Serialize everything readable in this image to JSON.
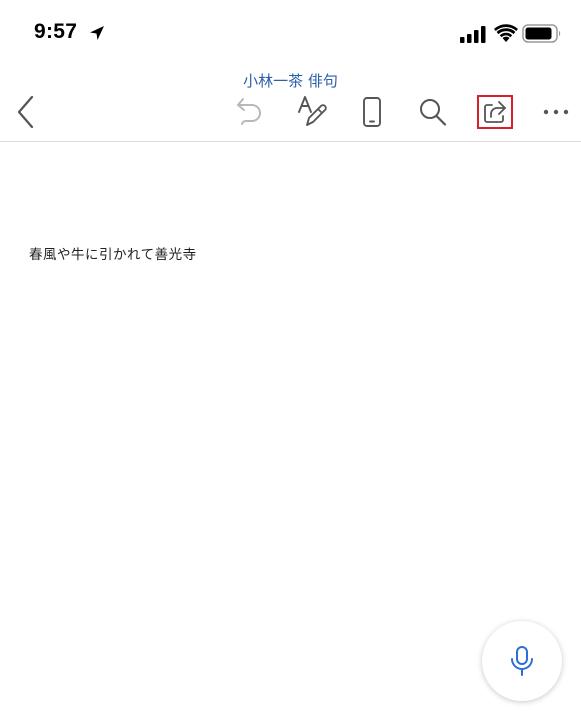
{
  "status_bar": {
    "time": "9:57",
    "icons": [
      "location-arrow-icon",
      "cellular-signal-icon",
      "wifi-icon",
      "battery-icon"
    ]
  },
  "document": {
    "title": "小林一茶 俳句",
    "body_text": "春風や牛に引かれて善光寺"
  },
  "toolbar": {
    "buttons": [
      {
        "name": "back",
        "icon": "chevron-left-icon"
      },
      {
        "name": "undo",
        "icon": "undo-icon",
        "enabled": false
      },
      {
        "name": "format",
        "icon": "text-format-pen-icon"
      },
      {
        "name": "mobile-view",
        "icon": "mobile-phone-icon"
      },
      {
        "name": "search",
        "icon": "search-icon"
      },
      {
        "name": "share",
        "icon": "share-icon",
        "highlighted": true
      },
      {
        "name": "more",
        "icon": "more-horizontal-icon"
      }
    ]
  },
  "colors": {
    "accent": "#2b5faa",
    "icon": "#555555",
    "icon_disabled": "#b8b8b8",
    "highlight_border": "#d6212a",
    "mic_icon": "#2b6fd6"
  },
  "mic_button": {
    "icon": "microphone-icon"
  }
}
